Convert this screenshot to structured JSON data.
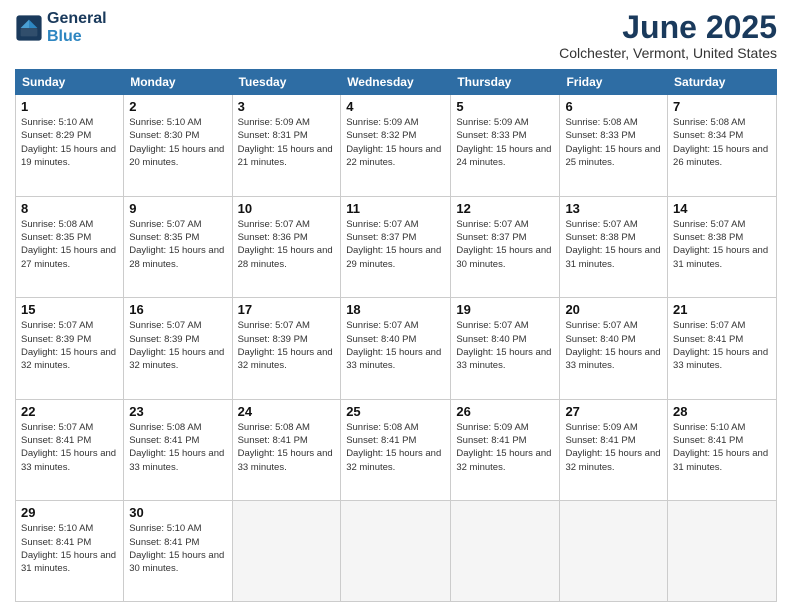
{
  "header": {
    "logo_general": "General",
    "logo_blue": "Blue",
    "title": "June 2025",
    "subtitle": "Colchester, Vermont, United States"
  },
  "weekdays": [
    "Sunday",
    "Monday",
    "Tuesday",
    "Wednesday",
    "Thursday",
    "Friday",
    "Saturday"
  ],
  "weeks": [
    [
      {
        "day": "1",
        "sunrise": "5:10 AM",
        "sunset": "8:29 PM",
        "daylight": "15 hours and 19 minutes."
      },
      {
        "day": "2",
        "sunrise": "5:10 AM",
        "sunset": "8:30 PM",
        "daylight": "15 hours and 20 minutes."
      },
      {
        "day": "3",
        "sunrise": "5:09 AM",
        "sunset": "8:31 PM",
        "daylight": "15 hours and 21 minutes."
      },
      {
        "day": "4",
        "sunrise": "5:09 AM",
        "sunset": "8:32 PM",
        "daylight": "15 hours and 22 minutes."
      },
      {
        "day": "5",
        "sunrise": "5:09 AM",
        "sunset": "8:33 PM",
        "daylight": "15 hours and 24 minutes."
      },
      {
        "day": "6",
        "sunrise": "5:08 AM",
        "sunset": "8:33 PM",
        "daylight": "15 hours and 25 minutes."
      },
      {
        "day": "7",
        "sunrise": "5:08 AM",
        "sunset": "8:34 PM",
        "daylight": "15 hours and 26 minutes."
      }
    ],
    [
      {
        "day": "8",
        "sunrise": "5:08 AM",
        "sunset": "8:35 PM",
        "daylight": "15 hours and 27 minutes."
      },
      {
        "day": "9",
        "sunrise": "5:07 AM",
        "sunset": "8:35 PM",
        "daylight": "15 hours and 28 minutes."
      },
      {
        "day": "10",
        "sunrise": "5:07 AM",
        "sunset": "8:36 PM",
        "daylight": "15 hours and 28 minutes."
      },
      {
        "day": "11",
        "sunrise": "5:07 AM",
        "sunset": "8:37 PM",
        "daylight": "15 hours and 29 minutes."
      },
      {
        "day": "12",
        "sunrise": "5:07 AM",
        "sunset": "8:37 PM",
        "daylight": "15 hours and 30 minutes."
      },
      {
        "day": "13",
        "sunrise": "5:07 AM",
        "sunset": "8:38 PM",
        "daylight": "15 hours and 31 minutes."
      },
      {
        "day": "14",
        "sunrise": "5:07 AM",
        "sunset": "8:38 PM",
        "daylight": "15 hours and 31 minutes."
      }
    ],
    [
      {
        "day": "15",
        "sunrise": "5:07 AM",
        "sunset": "8:39 PM",
        "daylight": "15 hours and 32 minutes."
      },
      {
        "day": "16",
        "sunrise": "5:07 AM",
        "sunset": "8:39 PM",
        "daylight": "15 hours and 32 minutes."
      },
      {
        "day": "17",
        "sunrise": "5:07 AM",
        "sunset": "8:39 PM",
        "daylight": "15 hours and 32 minutes."
      },
      {
        "day": "18",
        "sunrise": "5:07 AM",
        "sunset": "8:40 PM",
        "daylight": "15 hours and 33 minutes."
      },
      {
        "day": "19",
        "sunrise": "5:07 AM",
        "sunset": "8:40 PM",
        "daylight": "15 hours and 33 minutes."
      },
      {
        "day": "20",
        "sunrise": "5:07 AM",
        "sunset": "8:40 PM",
        "daylight": "15 hours and 33 minutes."
      },
      {
        "day": "21",
        "sunrise": "5:07 AM",
        "sunset": "8:41 PM",
        "daylight": "15 hours and 33 minutes."
      }
    ],
    [
      {
        "day": "22",
        "sunrise": "5:07 AM",
        "sunset": "8:41 PM",
        "daylight": "15 hours and 33 minutes."
      },
      {
        "day": "23",
        "sunrise": "5:08 AM",
        "sunset": "8:41 PM",
        "daylight": "15 hours and 33 minutes."
      },
      {
        "day": "24",
        "sunrise": "5:08 AM",
        "sunset": "8:41 PM",
        "daylight": "15 hours and 33 minutes."
      },
      {
        "day": "25",
        "sunrise": "5:08 AM",
        "sunset": "8:41 PM",
        "daylight": "15 hours and 32 minutes."
      },
      {
        "day": "26",
        "sunrise": "5:09 AM",
        "sunset": "8:41 PM",
        "daylight": "15 hours and 32 minutes."
      },
      {
        "day": "27",
        "sunrise": "5:09 AM",
        "sunset": "8:41 PM",
        "daylight": "15 hours and 32 minutes."
      },
      {
        "day": "28",
        "sunrise": "5:10 AM",
        "sunset": "8:41 PM",
        "daylight": "15 hours and 31 minutes."
      }
    ],
    [
      {
        "day": "29",
        "sunrise": "5:10 AM",
        "sunset": "8:41 PM",
        "daylight": "15 hours and 31 minutes."
      },
      {
        "day": "30",
        "sunrise": "5:10 AM",
        "sunset": "8:41 PM",
        "daylight": "15 hours and 30 minutes."
      },
      null,
      null,
      null,
      null,
      null
    ]
  ]
}
